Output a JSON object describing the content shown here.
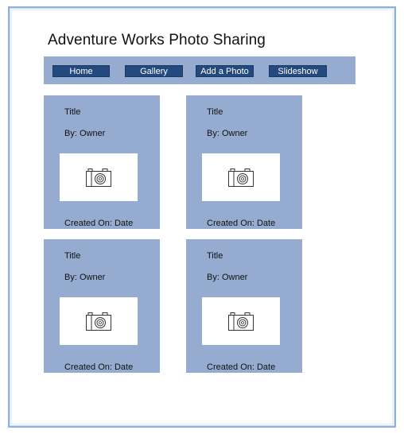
{
  "page": {
    "title": "Adventure Works Photo Sharing"
  },
  "nav": {
    "items": [
      {
        "label": "Home"
      },
      {
        "label": "Gallery"
      },
      {
        "label": "Add a Photo"
      },
      {
        "label": "Slideshow"
      }
    ]
  },
  "gallery": {
    "cards": [
      {
        "title": "Title",
        "owner": "By: Owner",
        "created": "Created On: Date",
        "photo_icon": "camera-icon"
      },
      {
        "title": "Title",
        "owner": "By: Owner",
        "created": "Created On: Date",
        "photo_icon": "camera-icon"
      },
      {
        "title": "Title",
        "owner": "By: Owner",
        "created": "Created On: Date",
        "photo_icon": "camera-icon"
      },
      {
        "title": "Title",
        "owner": "By: Owner",
        "created": "Created On: Date",
        "photo_icon": "camera-icon"
      }
    ]
  },
  "colors": {
    "navbar_bg": "#95acd0",
    "nav_button_bg": "#23497f",
    "card_bg": "#95acd0",
    "frame_border": "#8fb2e3"
  }
}
